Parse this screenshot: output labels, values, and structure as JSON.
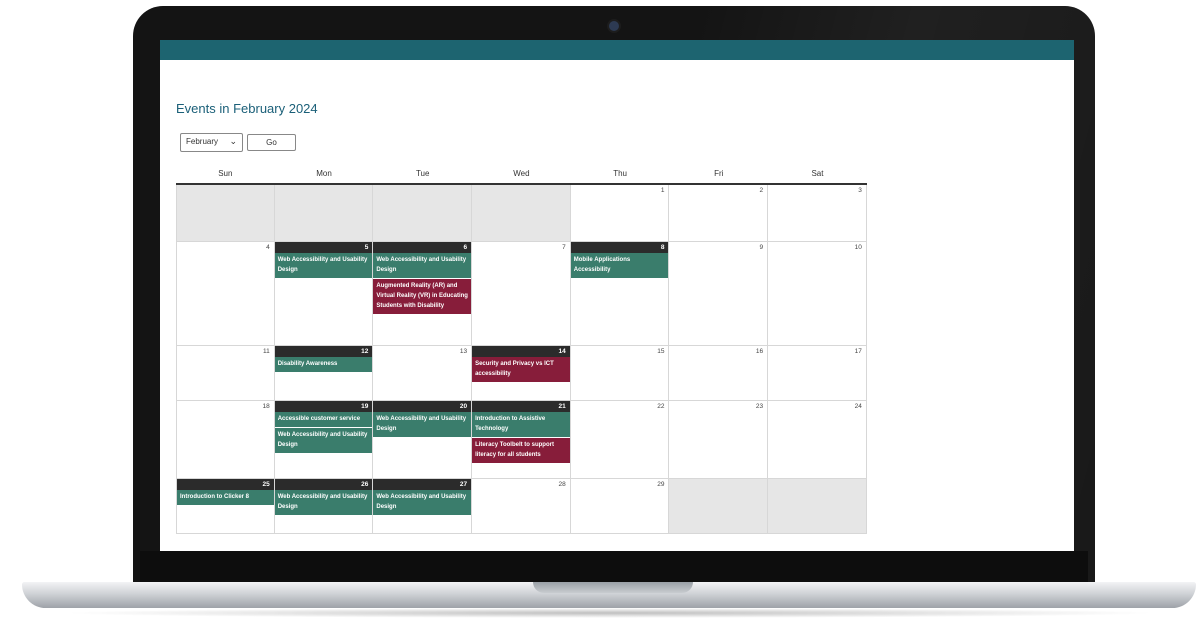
{
  "page": {
    "title": "Events in February 2024"
  },
  "controls": {
    "month_selected": "February",
    "go_label": "Go"
  },
  "calendar": {
    "weekdays": [
      "Sun",
      "Mon",
      "Tue",
      "Wed",
      "Thu",
      "Fri",
      "Sat"
    ],
    "weeks": [
      [
        {
          "day": "",
          "events": []
        },
        {
          "day": "",
          "events": []
        },
        {
          "day": "",
          "events": []
        },
        {
          "day": "",
          "events": []
        },
        {
          "day": "1",
          "events": []
        },
        {
          "day": "2",
          "events": []
        },
        {
          "day": "3",
          "events": []
        }
      ],
      [
        {
          "day": "4",
          "events": []
        },
        {
          "day": "5",
          "events": [
            {
              "title": "Web Accessibility and Usability Design",
              "type": "green"
            }
          ]
        },
        {
          "day": "6",
          "events": [
            {
              "title": "Web Accessibility and Usability Design",
              "type": "green"
            },
            {
              "title": "Augmented Reality (AR) and Virtual Reality (VR) in Educating Students with Disability",
              "type": "red"
            }
          ]
        },
        {
          "day": "7",
          "events": []
        },
        {
          "day": "8",
          "events": [
            {
              "title": "Mobile Applications Accessibility",
              "type": "green"
            }
          ]
        },
        {
          "day": "9",
          "events": []
        },
        {
          "day": "10",
          "events": []
        }
      ],
      [
        {
          "day": "11",
          "events": []
        },
        {
          "day": "12",
          "events": [
            {
              "title": "Disability Awareness",
              "type": "green"
            }
          ]
        },
        {
          "day": "13",
          "events": []
        },
        {
          "day": "14",
          "events": [
            {
              "title": "Security and Privacy vs ICT accessibility",
              "type": "red"
            }
          ]
        },
        {
          "day": "15",
          "events": []
        },
        {
          "day": "16",
          "events": []
        },
        {
          "day": "17",
          "events": []
        }
      ],
      [
        {
          "day": "18",
          "events": []
        },
        {
          "day": "19",
          "events": [
            {
              "title": "Accessible customer service",
              "type": "green"
            },
            {
              "title": "Web Accessibility and Usability Design",
              "type": "green"
            }
          ]
        },
        {
          "day": "20",
          "events": [
            {
              "title": "Web Accessibility and Usability Design",
              "type": "green"
            }
          ]
        },
        {
          "day": "21",
          "events": [
            {
              "title": "Introduction to Assistive Technology",
              "type": "green"
            },
            {
              "title": "Literacy Toolbelt to support literacy for all students",
              "type": "red"
            }
          ]
        },
        {
          "day": "22",
          "events": []
        },
        {
          "day": "23",
          "events": []
        },
        {
          "day": "24",
          "events": []
        }
      ],
      [
        {
          "day": "25",
          "events": [
            {
              "title": "Introduction to Clicker 8",
              "type": "green"
            }
          ]
        },
        {
          "day": "26",
          "events": [
            {
              "title": "Web Accessibility and Usability Design",
              "type": "green"
            }
          ]
        },
        {
          "day": "27",
          "events": [
            {
              "title": "Web Accessibility and Usability Design",
              "type": "green"
            }
          ]
        },
        {
          "day": "28",
          "events": []
        },
        {
          "day": "29",
          "events": []
        },
        {
          "day": "",
          "events": []
        },
        {
          "day": "",
          "events": []
        }
      ]
    ]
  },
  "colors": {
    "header_bar": "#1d6470",
    "event_green": "#3a7d6c",
    "event_red": "#871d3a",
    "day_header_dark": "#2b2b2b",
    "empty_cell": "#e6e6e6"
  }
}
